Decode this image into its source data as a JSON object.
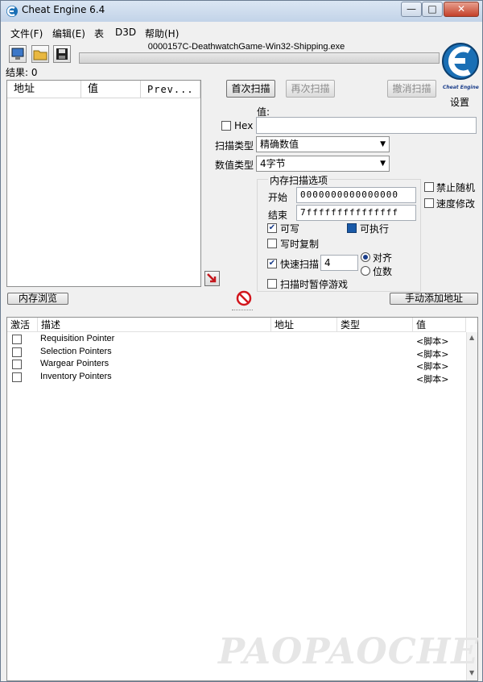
{
  "window": {
    "title": "Cheat Engine 6.4",
    "minimize": "—",
    "maximize": "□",
    "close": "✕"
  },
  "menu": [
    "文件(F)",
    "编辑(E)",
    "表",
    "D3D",
    "帮助(H)"
  ],
  "process_name": "0000157C-DeathwatchGame-Win32-Shipping.exe",
  "results_label": "结果: 0",
  "settings_label": "设置",
  "logo_text": "Cheat Engine",
  "results_columns": [
    "地址",
    "值",
    "Prev..."
  ],
  "scan": {
    "first_scan": "首次扫描",
    "next_scan": "再次扫描",
    "undo_scan": "撤消扫描",
    "value_label": "值:",
    "hex_label": "Hex",
    "value_input": "",
    "scan_type_label": "扫描类型",
    "scan_type_value": "精确数值",
    "value_type_label": "数值类型",
    "value_type_value": "4字节"
  },
  "memory_options": {
    "title": "内存扫描选项",
    "start_label": "开始",
    "start_value": "0000000000000000",
    "end_label": "结束",
    "end_value": "7fffffffffffffff",
    "writable_label": "可写",
    "writable_checked": true,
    "executable_label": "可执行",
    "executable_checked": true,
    "copy_on_write_label": "写时复制",
    "copy_on_write_checked": false,
    "fast_scan_label": "快速扫描",
    "fast_scan_checked": true,
    "fast_scan_value": "4",
    "align_label": "对齐",
    "digits_label": "位数",
    "pause_label": "扫描时暂停游戏",
    "pause_checked": false
  },
  "right_options": {
    "no_random_label": "禁止随机",
    "speedhack_label": "速度修改"
  },
  "memory_view_button": "内存浏览",
  "add_address_button": "手动添加地址",
  "table_columns": [
    "激活",
    "描述",
    "地址",
    "类型",
    "值"
  ],
  "table_rows": [
    {
      "description": "Requisition Pointer",
      "value": "<脚本>"
    },
    {
      "description": "Selection Pointers",
      "value": "<脚本>"
    },
    {
      "description": "Wargear Pointers",
      "value": "<脚本>"
    },
    {
      "description": "Inventory Pointers",
      "value": "<脚本>"
    }
  ],
  "watermark": "PAOPAOCHE",
  "colors": {
    "titlebar": "#c2d3e8",
    "close_button": "#c4412a",
    "logo_blue": "#1a6fb5"
  }
}
